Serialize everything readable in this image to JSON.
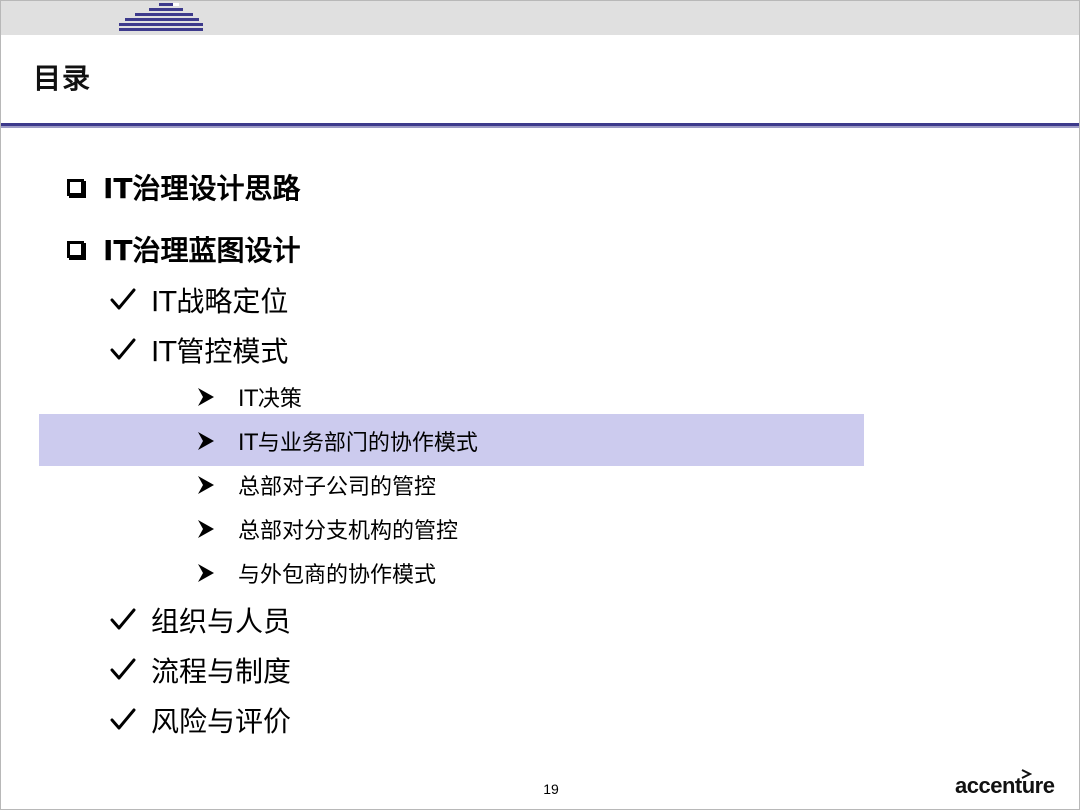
{
  "slide": {
    "title": "目录",
    "page_number": "19",
    "logo_text": "accenture"
  },
  "agenda": {
    "sections": [
      {
        "label": "IT治理设计思路"
      },
      {
        "label": "IT治理蓝图设计"
      }
    ],
    "sub_items": [
      {
        "label": "IT战略定位"
      },
      {
        "label": "IT管控模式"
      },
      {
        "label": "组织与人员"
      },
      {
        "label": "流程与制度"
      },
      {
        "label": "风险与评价"
      }
    ],
    "detail_items": [
      {
        "label": "IT决策"
      },
      {
        "label": "IT与业务部门的协作模式"
      },
      {
        "label": "总部对子公司的管控"
      },
      {
        "label": "总部对分支机构的管控"
      },
      {
        "label": "与外包商的协作模式"
      }
    ]
  },
  "colors": {
    "rule": "#3d3a8c",
    "highlight": "#cccbee",
    "header_band": "#e0e0e0",
    "stripes": "#3d3a8c"
  },
  "icons": {
    "section_bullet": "square-box-icon",
    "sub_bullet": "checkmark-icon",
    "detail_bullet": "arrowhead-icon"
  }
}
